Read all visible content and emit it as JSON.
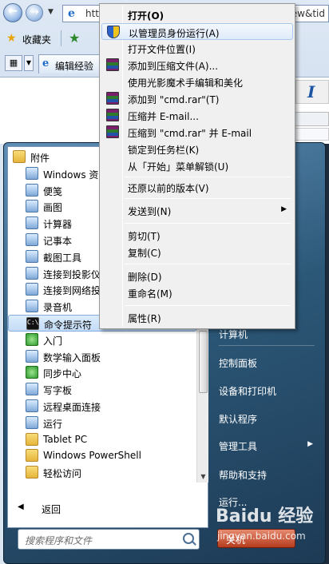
{
  "browser": {
    "url_start": "http",
    "url_end": "ew&tid",
    "favorites_label": "收藏夹",
    "tab_title": "编辑经验"
  },
  "start_menu": {
    "items": [
      {
        "label": "附件",
        "icon": "folder-icon"
      },
      {
        "label": "Windows 资源",
        "icon": "explorer-icon"
      },
      {
        "label": "便笺",
        "icon": "sticky-note-icon"
      },
      {
        "label": "画图",
        "icon": "paint-icon"
      },
      {
        "label": "计算器",
        "icon": "calculator-icon"
      },
      {
        "label": "记事本",
        "icon": "notepad-icon"
      },
      {
        "label": "截图工具",
        "icon": "scissors-icon"
      },
      {
        "label": "连接到投影仪",
        "icon": "projector-icon"
      },
      {
        "label": "连接到网络投",
        "icon": "network-projector-icon"
      },
      {
        "label": "录音机",
        "icon": "microphone-icon"
      },
      {
        "label": "命令提示符",
        "icon": "cmd-icon"
      },
      {
        "label": "入门",
        "icon": "getting-started-icon"
      },
      {
        "label": "数学输入面板",
        "icon": "math-panel-icon"
      },
      {
        "label": "同步中心",
        "icon": "sync-icon"
      },
      {
        "label": "写字板",
        "icon": "wordpad-icon"
      },
      {
        "label": "远程桌面连接",
        "icon": "remote-desktop-icon"
      },
      {
        "label": "运行",
        "icon": "run-icon"
      },
      {
        "label": "Tablet PC",
        "icon": "folder-icon"
      },
      {
        "label": "Windows PowerShell",
        "icon": "folder-icon"
      },
      {
        "label": "轻松访问",
        "icon": "folder-icon"
      }
    ],
    "back_label": "返回",
    "search_placeholder": "搜索程序和文件",
    "right_items": [
      {
        "label": "计算机"
      },
      {
        "label": "控制面板"
      },
      {
        "label": "设备和打印机"
      },
      {
        "label": "默认程序"
      },
      {
        "label": "管理工具",
        "has_submenu": true
      },
      {
        "label": "帮助和支持"
      },
      {
        "label": "运行..."
      }
    ],
    "power_label": "关机"
  },
  "context_menu": {
    "items": [
      {
        "label": "打开(O)",
        "bold": true
      },
      {
        "label": "以管理员身份运行(A)",
        "icon": "uac-shield-icon",
        "highlighted": true
      },
      {
        "label": "打开文件位置(I)"
      },
      {
        "label": "添加到压缩文件(A)...",
        "icon": "winrar-icon"
      },
      {
        "label": "使用光影魔术手编辑和美化"
      },
      {
        "label": "添加到 \"cmd.rar\"(T)",
        "icon": "winrar-icon"
      },
      {
        "label": "压缩并 E-mail...",
        "icon": "winrar-icon"
      },
      {
        "label": "压缩到 \"cmd.rar\" 并 E-mail",
        "icon": "winrar-icon"
      },
      {
        "label": "锁定到任务栏(K)"
      },
      {
        "label": "从「开始」菜单解锁(U)"
      },
      {
        "label": "还原以前的版本(V)"
      },
      {
        "label": "发送到(N)",
        "has_submenu": true
      },
      {
        "label": "剪切(T)"
      },
      {
        "label": "复制(C)"
      },
      {
        "label": "删除(D)"
      },
      {
        "label": "重命名(M)"
      },
      {
        "label": "属性(R)"
      }
    ]
  },
  "watermark": {
    "text": "Baidu 经验",
    "sub": "jingyan.baidu.com"
  }
}
